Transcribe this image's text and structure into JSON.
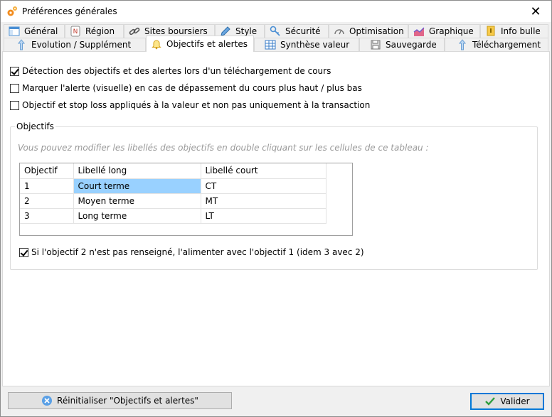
{
  "window": {
    "title": "Préférences générales",
    "close_glyph": "✕"
  },
  "tabs": {
    "row1": [
      {
        "label": "Général",
        "icon": "window-icon"
      },
      {
        "label": "Région",
        "icon": "region-icon"
      },
      {
        "label": "Sites boursiers",
        "icon": "link-icon"
      },
      {
        "label": "Style",
        "icon": "pen-icon"
      },
      {
        "label": "Sécurité",
        "icon": "key-icon"
      },
      {
        "label": "Optimisation",
        "icon": "gauge-icon"
      },
      {
        "label": "Graphique",
        "icon": "chart-icon"
      },
      {
        "label": "Info bulle",
        "icon": "note-icon"
      }
    ],
    "row2": [
      {
        "label": "Evolution / Supplément",
        "icon": "arrow-up-icon"
      },
      {
        "label": "Objectifs et alertes",
        "icon": "bell-icon"
      },
      {
        "label": "Synthèse valeur",
        "icon": "table-icon"
      },
      {
        "label": "Sauvegarde",
        "icon": "disk-icon"
      },
      {
        "label": "Téléchargement",
        "icon": "arrow-up-icon"
      }
    ],
    "active": "Objectifs et alertes"
  },
  "options": {
    "detect": {
      "label": "Détection des objectifs et des alertes lors d'un téléchargement de cours",
      "checked": true
    },
    "visual": {
      "label": "Marquer l'alerte (visuelle) en cas de dépassement du cours plus haut / plus bas",
      "checked": false
    },
    "stoploss": {
      "label": "Objectif et stop loss appliqués à la valeur et non pas uniquement à la transaction",
      "checked": false
    }
  },
  "objectives": {
    "legend": "Objectifs",
    "hint": "Vous pouvez modifier les libellés des objectifs en double cliquant sur les cellules de ce tableau :",
    "columns": [
      "Objectif",
      "Libellé long",
      "Libellé court"
    ],
    "rows": [
      {
        "num": "1",
        "long": "Court terme",
        "short": "CT"
      },
      {
        "num": "2",
        "long": "Moyen terme",
        "short": "MT"
      },
      {
        "num": "3",
        "long": "Long terme",
        "short": "LT"
      }
    ],
    "feed": {
      "label": "Si l'objectif 2 n'est pas renseigné, l'alimenter avec l'objectif 1 (idem 3 avec 2)",
      "checked": true
    }
  },
  "buttons": {
    "reset": "Réinitialiser \"Objectifs et alertes\"",
    "validate": "Valider"
  },
  "colors": {
    "selection": "#99d1ff",
    "accent": "#0078d7"
  }
}
